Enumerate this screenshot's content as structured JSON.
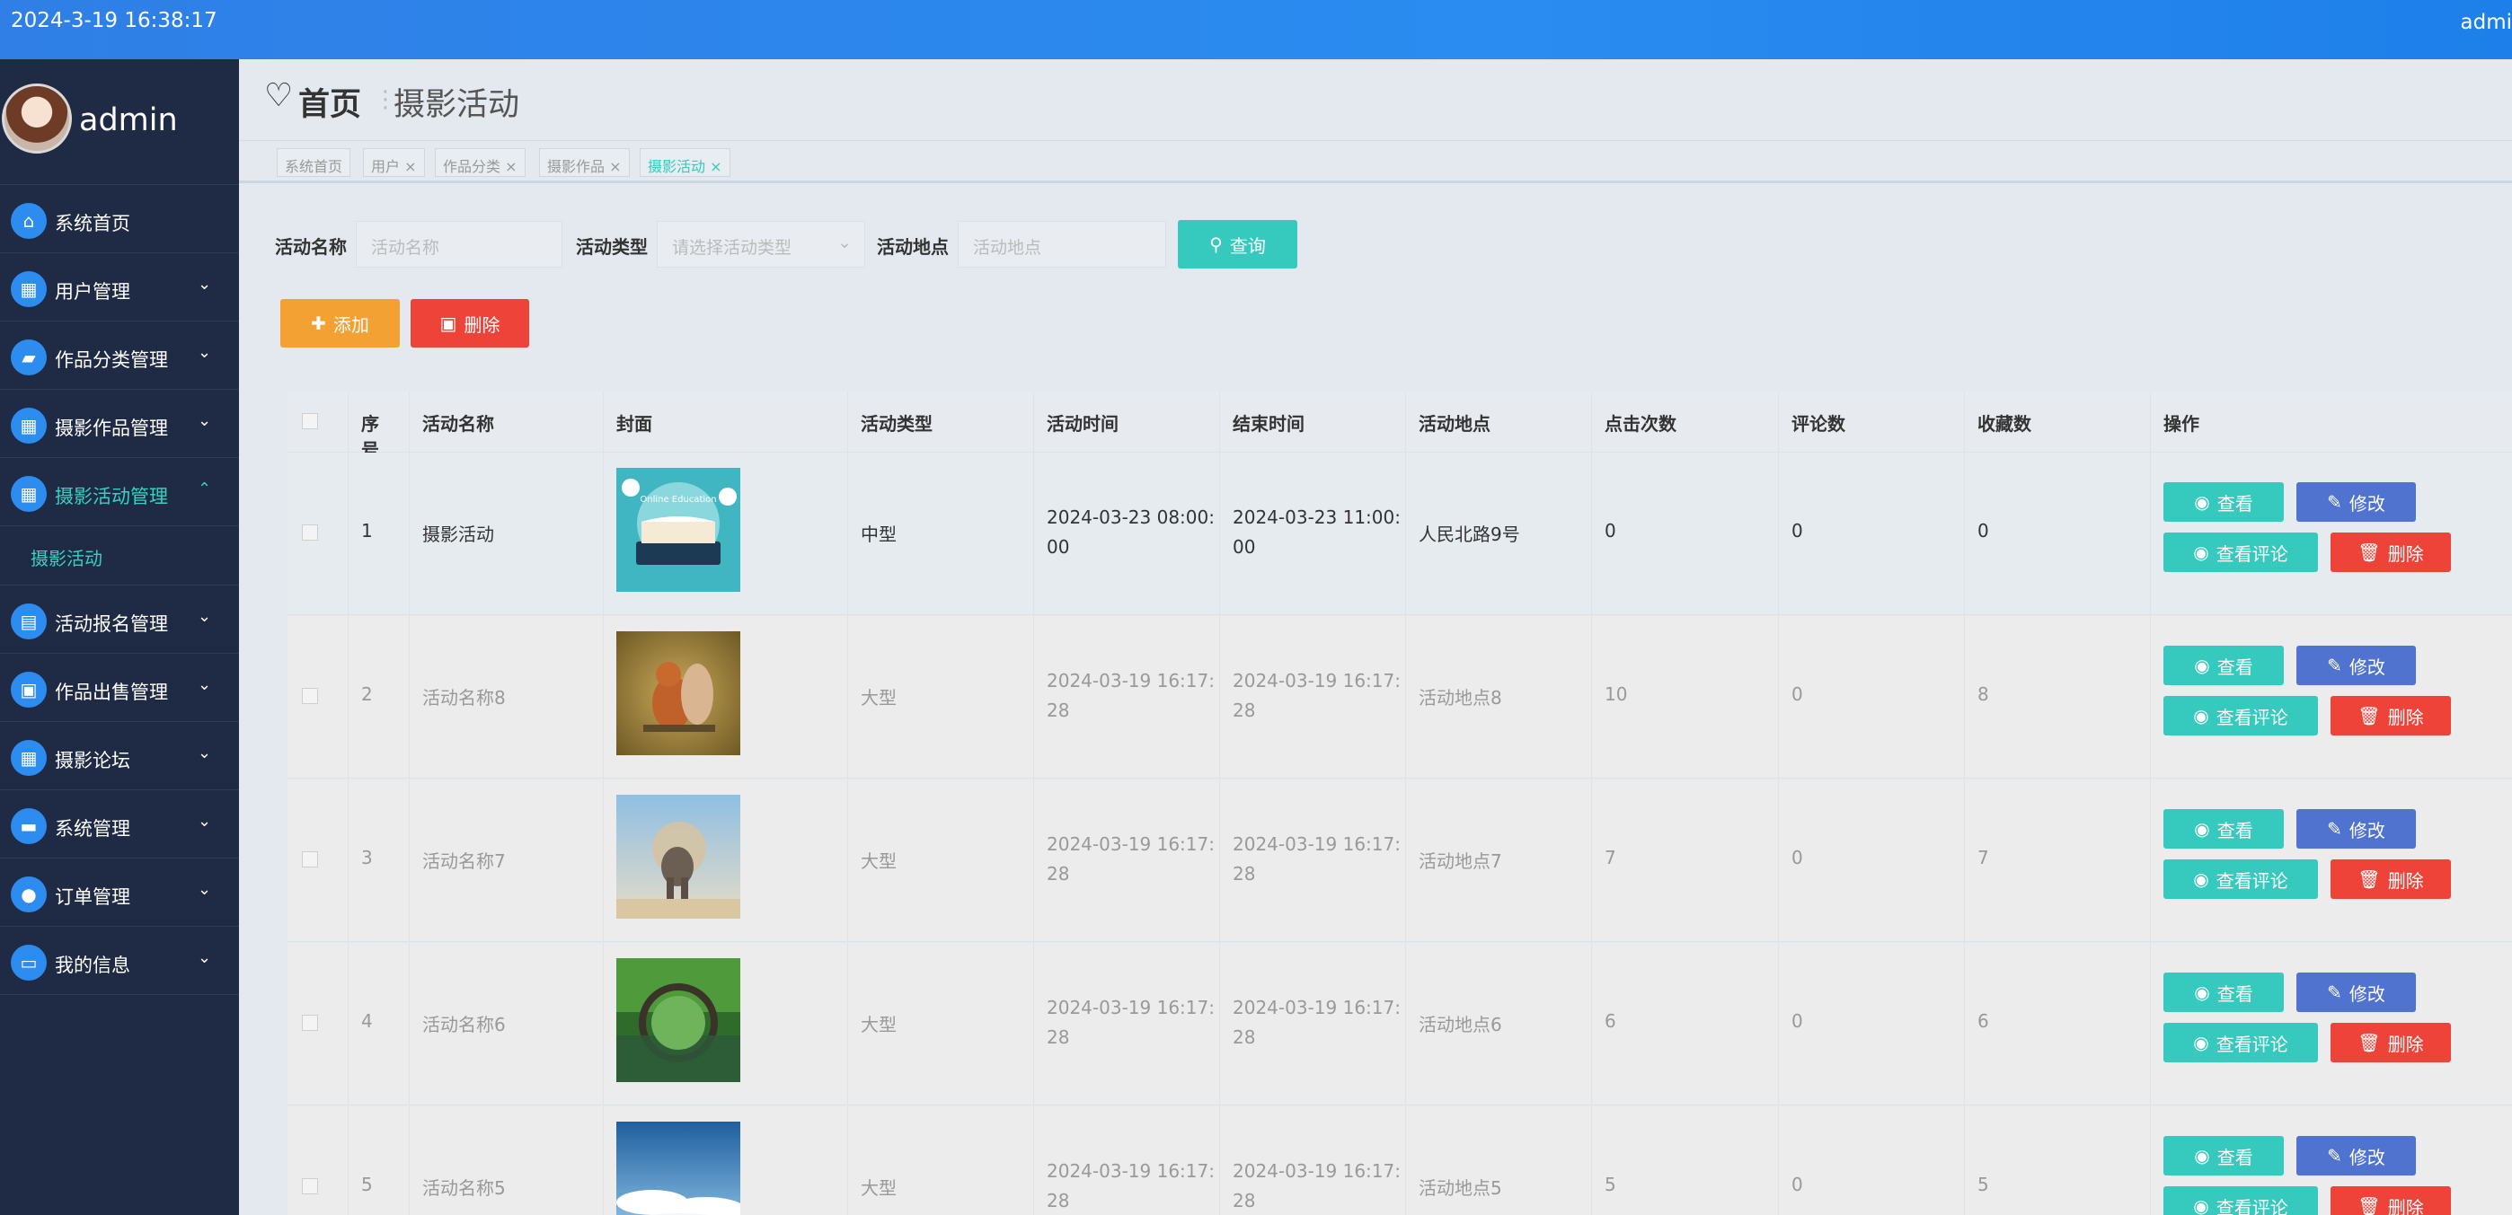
{
  "topbar": {
    "datetime": "2024-3-19 16:38:17",
    "user": "admi"
  },
  "profile": {
    "name": "admin"
  },
  "menu": [
    {
      "label": "系统首页",
      "icon": "home-icon",
      "glyph": "⌂",
      "chevron": ""
    },
    {
      "label": "用户管理",
      "icon": "grid-icon",
      "glyph": "▦",
      "chevron": "⌄"
    },
    {
      "label": "作品分类管理",
      "icon": "category-icon",
      "glyph": "▰",
      "chevron": "⌄"
    },
    {
      "label": "摄影作品管理",
      "icon": "grid-icon",
      "glyph": "▦",
      "chevron": "⌄"
    },
    {
      "label": "摄影活动管理",
      "icon": "grid-icon",
      "glyph": "▦",
      "chevron": "⌃"
    },
    {
      "label": "活动报名管理",
      "icon": "clipboard-icon",
      "glyph": "▤",
      "chevron": "⌄"
    },
    {
      "label": "作品出售管理",
      "icon": "briefcase-icon",
      "glyph": "▣",
      "chevron": "⌄"
    },
    {
      "label": "摄影论坛",
      "icon": "grid-icon",
      "glyph": "▦",
      "chevron": "⌄"
    },
    {
      "label": "系统管理",
      "icon": "chat-icon",
      "glyph": "▬",
      "chevron": "⌄"
    },
    {
      "label": "订单管理",
      "icon": "user-icon",
      "glyph": "●",
      "chevron": "⌄"
    },
    {
      "label": "我的信息",
      "icon": "card-icon",
      "glyph": "▭",
      "chevron": "⌄"
    }
  ],
  "submenu_label": "摄影活动",
  "breadcrumb": {
    "home": "首页",
    "sep": "⋮",
    "current": "摄影活动"
  },
  "tabs": [
    {
      "label": "系统首页"
    },
    {
      "label": "用户 ×"
    },
    {
      "label": "作品分类 ×"
    },
    {
      "label": "摄影作品 ×"
    },
    {
      "label": "摄影活动 ×"
    }
  ],
  "search": {
    "name_label": "活动名称",
    "name_placeholder": "活动名称",
    "type_label": "活动类型",
    "type_placeholder": "请选择活动类型",
    "place_label": "活动地点",
    "place_placeholder": "活动地点",
    "query_button": "查询"
  },
  "actions": {
    "add": "添加",
    "delete": "删除"
  },
  "table": {
    "headers": [
      "序号",
      "活动名称",
      "封面",
      "活动类型",
      "活动时间",
      "结束时间",
      "活动地点",
      "点击次数",
      "评论数",
      "收藏数",
      "操作"
    ],
    "row_buttons": {
      "view": "查看",
      "edit": "修改",
      "comments": "查看评论",
      "delete": "删除"
    },
    "rows": [
      {
        "no": "1",
        "name": "摄影活动",
        "type": "中型",
        "start": "2024-03-23 08:00:00",
        "end": "2024-03-23 11:00:00",
        "place": "人民北路9号",
        "clicks": "0",
        "comments": "0",
        "favorites": "0",
        "cover": "laptop-book-cover"
      },
      {
        "no": "2",
        "name": "活动名称8",
        "type": "大型",
        "start": "2024-03-19 16:17:28",
        "end": "2024-03-19 16:17:28",
        "place": "活动地点8",
        "clicks": "10",
        "comments": "0",
        "favorites": "8",
        "cover": "squirrel-photo"
      },
      {
        "no": "3",
        "name": "活动名称7",
        "type": "大型",
        "start": "2024-03-19 16:17:28",
        "end": "2024-03-19 16:17:28",
        "place": "活动地点7",
        "clicks": "7",
        "comments": "0",
        "favorites": "7",
        "cover": "elephant-dust-photo"
      },
      {
        "no": "4",
        "name": "活动名称6",
        "type": "大型",
        "start": "2024-03-19 16:17:28",
        "end": "2024-03-19 16:17:28",
        "place": "活动地点6",
        "clicks": "6",
        "comments": "0",
        "favorites": "6",
        "cover": "forest-bridge-photo"
      },
      {
        "no": "5",
        "name": "活动名称5",
        "type": "大型",
        "start": "2024-03-19 16:17:28",
        "end": "2024-03-19 16:17:28",
        "place": "活动地点5",
        "clicks": "5",
        "comments": "0",
        "favorites": "5",
        "cover": "sky-clouds-photo"
      }
    ]
  },
  "colors": {
    "accent": "#36c9bd",
    "primary": "#2d8cf0",
    "danger": "#ee4339",
    "warning": "#f2a132",
    "edit": "#5173d0",
    "sidebar": "#1f2a44"
  }
}
